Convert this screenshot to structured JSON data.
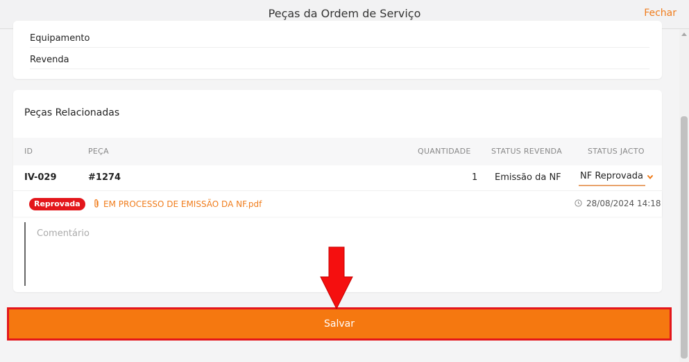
{
  "header": {
    "title": "Peças da Ordem de Serviço",
    "close_label": "Fechar"
  },
  "details": {
    "rows": [
      "Equipamento",
      "Revenda"
    ]
  },
  "parts": {
    "section_title": "Peças Relacionadas",
    "columns": [
      "ID",
      "PEÇA",
      "QUANTIDADE",
      "STATUS REVENDA",
      "STATUS JACTO"
    ],
    "row": {
      "id": "IV-029",
      "part": "#1274",
      "quantity": "1",
      "status_revenda": "Emissão da NF",
      "status_jacto": "NF Reprovada"
    },
    "attachment": {
      "badge": "Reprovada",
      "file_name": "EM PROCESSO DE EMISSÃO DA NF.pdf",
      "timestamp": "28/08/2024 14:18"
    },
    "comment": {
      "placeholder": "Comentário",
      "value": ""
    }
  },
  "footer": {
    "save_label": "Salvar"
  },
  "colors": {
    "accent": "#f57810",
    "alert": "#e3161b"
  },
  "icons": {
    "attachment": "paperclip-icon",
    "time": "clock-icon",
    "dropdown": "chevron-down-icon",
    "annotation": "arrow-down-icon"
  }
}
